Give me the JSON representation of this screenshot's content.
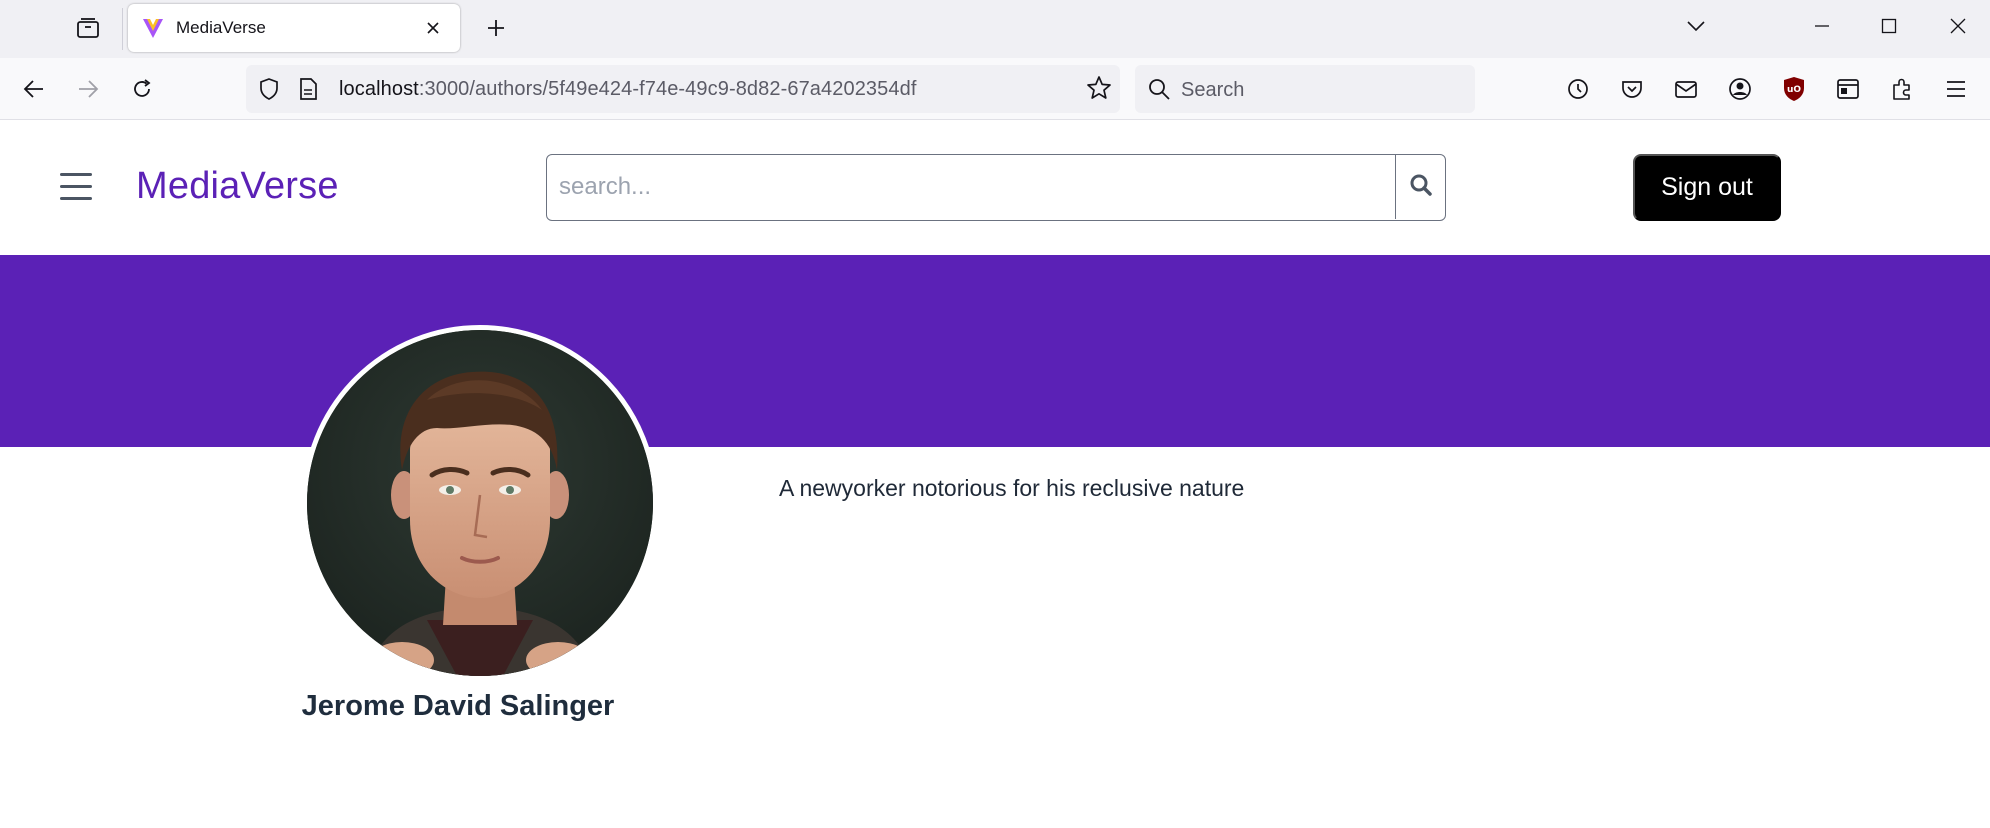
{
  "browser": {
    "tab_title": "MediaVerse",
    "url_host": "localhost",
    "url_path": ":3000/authors/5f49e424-f74e-49c9-8d82-67a4202354df",
    "search_placeholder": "Search",
    "icons": [
      "tab-list-icon",
      "favicon-icon",
      "close-icon",
      "plus-icon",
      "chevron-down-icon",
      "minimize-icon",
      "maximize-icon",
      "close-window-icon",
      "back-icon",
      "forward-icon",
      "reload-icon",
      "shield-icon",
      "page-icon",
      "star-icon",
      "search-icon",
      "history-icon",
      "pocket-icon",
      "mail-icon",
      "account-icon",
      "ublock-icon",
      "container-icon",
      "extensions-icon",
      "menu-icon"
    ]
  },
  "header": {
    "brand": "MediaVerse",
    "search_placeholder": "search...",
    "signout_label": "Sign out"
  },
  "colors": {
    "brand": "#5b21b6",
    "banner": "#5b21b6",
    "signout_bg": "#000000"
  },
  "author": {
    "name": "Jerome David Salinger",
    "bio": "A newyorker notorious for his reclusive nature"
  }
}
